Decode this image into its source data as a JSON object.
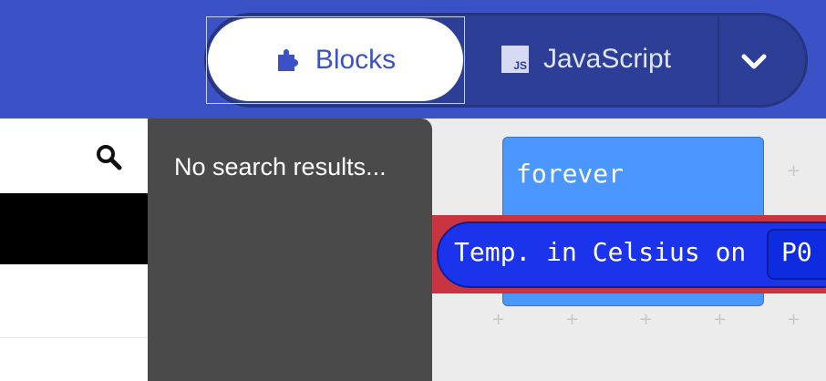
{
  "header": {
    "tabs": [
      {
        "label": "Blocks",
        "icon": "puzzle-icon",
        "active": true
      },
      {
        "label": "JavaScript",
        "icon": "js-file-icon",
        "badge_text": "JS",
        "active": false
      }
    ],
    "menu_icon": "chevron-down-icon"
  },
  "toolbox": {
    "search_icon": "search-icon",
    "flyout_message": "No search results..."
  },
  "workspace": {
    "forever_block": "forever",
    "temp_block": "Temp. in Celsius on",
    "pin_value": "P0"
  },
  "colors": {
    "topbar": "#3b52c7",
    "forever": "#4c97ff",
    "temp_block": "#1b33ea",
    "error_highlight": "#c8343f",
    "flyout": "#4b4a4a"
  }
}
